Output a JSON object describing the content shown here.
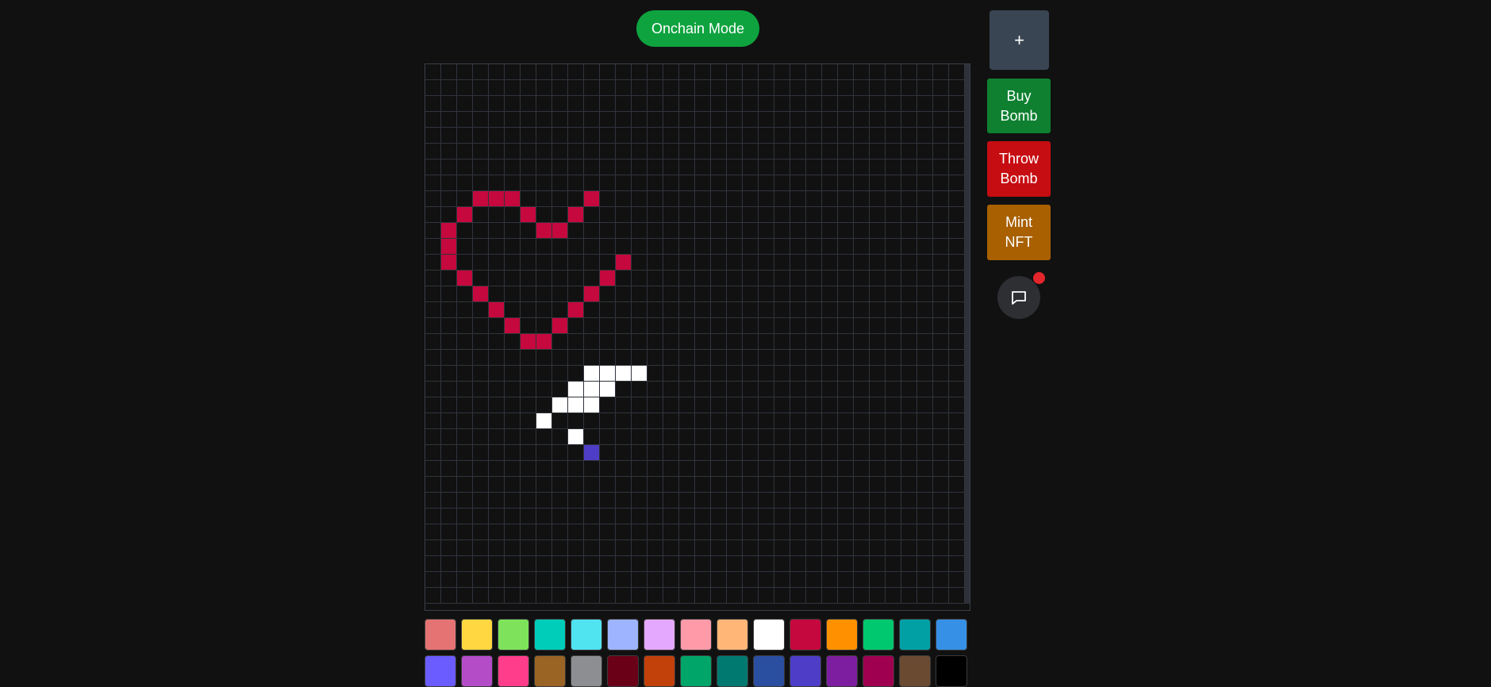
{
  "mode_button": {
    "label": "Onchain Mode"
  },
  "side": {
    "plus_label": "+",
    "buy_bomb_label": [
      "Buy",
      "Bomb"
    ],
    "throw_bomb_label": [
      "Throw",
      "Bomb"
    ],
    "mint_nft_label": [
      "Mint",
      "NFT"
    ],
    "chat_icon": "chat-bubble-icon",
    "chat_unread": true
  },
  "colors": {
    "background": "#111111",
    "grid_line": "#30343c",
    "mode_button": "#0ea33f",
    "plus_button": "#3a4553",
    "buy_bomb": "#0e8030",
    "throw_bomb": "#c60d12",
    "mint_nft": "#a86000",
    "notification_dot": "#e3262b"
  },
  "canvas": {
    "columns": 34,
    "rows": 34,
    "empty_color": "#111111",
    "legend": {
      "R": "#c5083d",
      "W": "#ffffff",
      "B": "#4e3dc6",
      "D": "#2a4ea0"
    },
    "rows_data": [
      "..................................",
      "..................................",
      "..................................",
      "..................................",
      "..................................",
      "..................................",
      "..................................",
      "..................................",
      "...RRR....R.......................",
      "..R...R..R........................",
      ".R.....RR.........................",
      ".R................................",
      ".R..........R.....................",
      "..R........R......................",
      "...R......R.......................",
      "....R....R........................",
      ".....R..R.........................",
      "......RR..........................",
      "..................................",
      "..........WWWW....................",
      ".........WWW......................",
      "........WWW.......................",
      ".......W..........................",
      ".........W........................",
      "..........B.......................",
      "..................................",
      "..................................",
      "..................................",
      "..................................",
      "..................................",
      "..................................",
      "..................................",
      "..................................",
      ".................................."
    ]
  },
  "palette": [
    "#e57373",
    "#ffd740",
    "#7ee35b",
    "#00cdb9",
    "#50e3f0",
    "#9eb4ff",
    "#e5a8ff",
    "#ff9aa8",
    "#ffb677",
    "#ffffff",
    "#c5083d",
    "#ff9000",
    "#00c86e",
    "#00a0a5",
    "#3690e6",
    "#6a5cff",
    "#b44cc8",
    "#ff3d8b",
    "#9a6424",
    "#8c8e92",
    "#6a0018",
    "#c2400a",
    "#00a56a",
    "#007a70",
    "#2a4ea0",
    "#4e3dc6",
    "#7d1ea0",
    "#a00050",
    "#6b4a32",
    "#000000"
  ]
}
